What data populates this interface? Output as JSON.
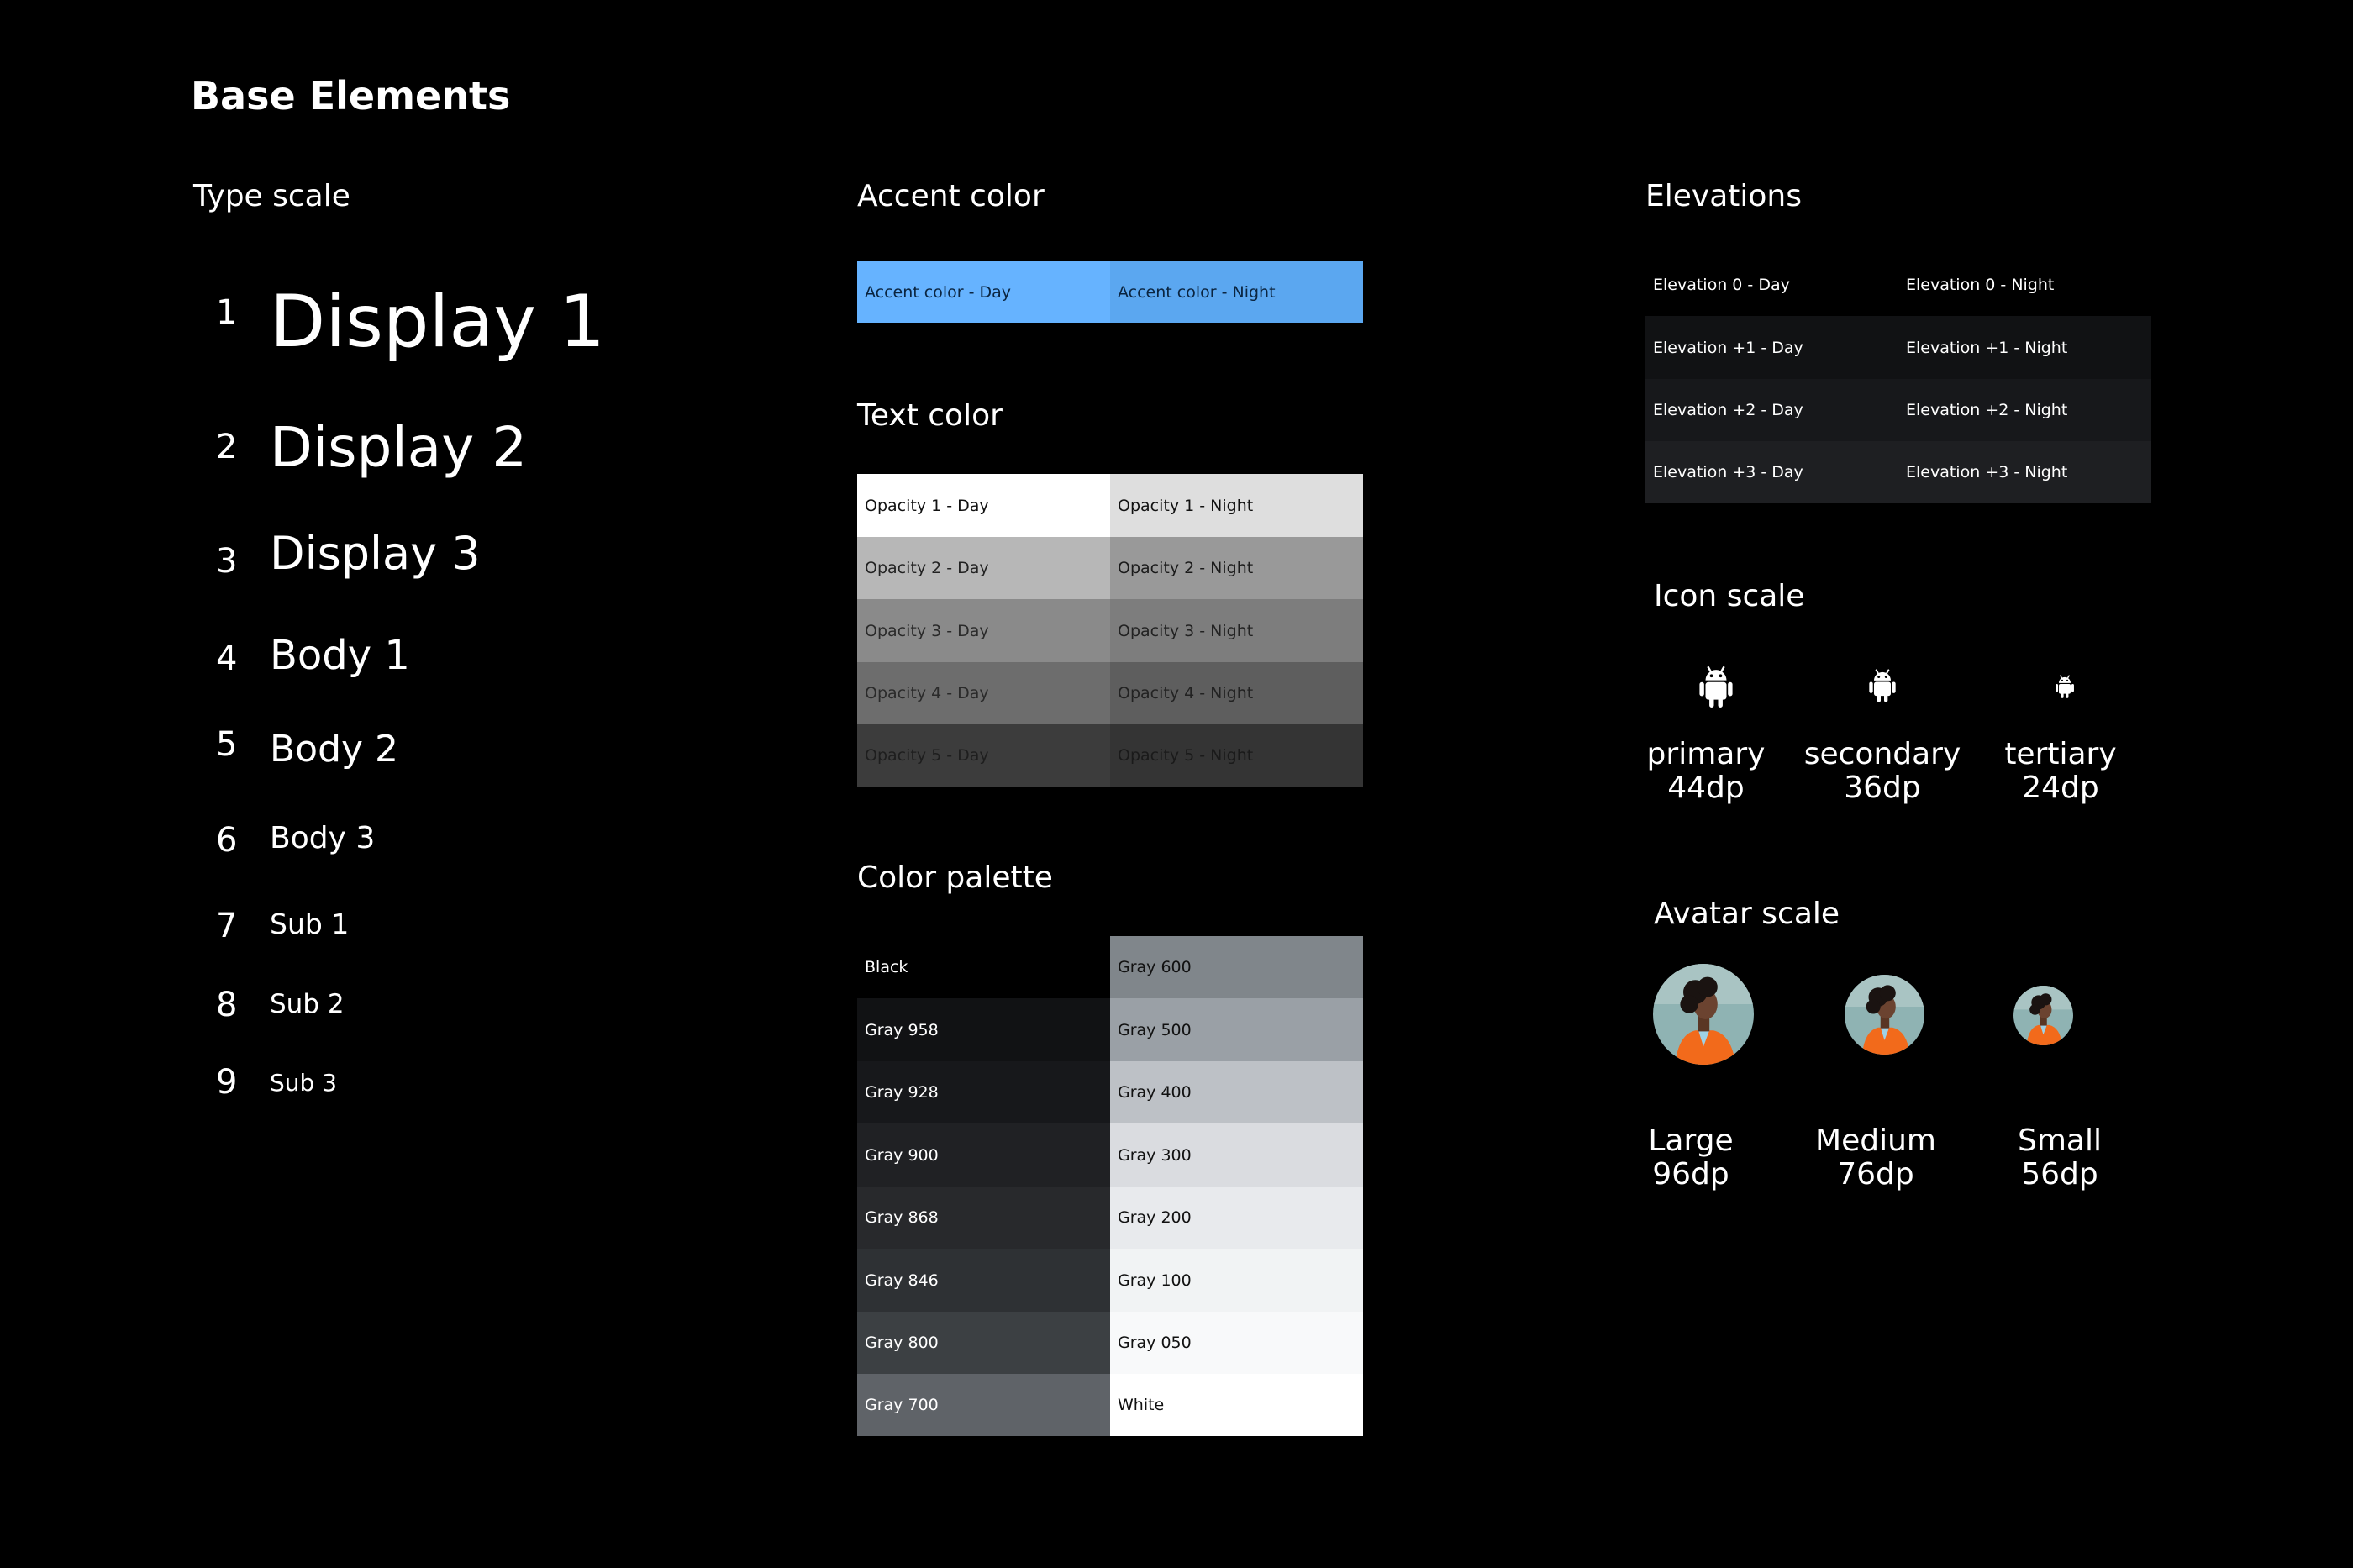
{
  "page": {
    "title": "Base Elements"
  },
  "type_scale": {
    "title": "Type scale",
    "items": [
      {
        "num": "1",
        "label": "Display 1"
      },
      {
        "num": "2",
        "label": "Display 2"
      },
      {
        "num": "3",
        "label": "Display 3"
      },
      {
        "num": "4",
        "label": "Body 1"
      },
      {
        "num": "5",
        "label": "Body 2"
      },
      {
        "num": "6",
        "label": "Body 3"
      },
      {
        "num": "7",
        "label": "Sub 1"
      },
      {
        "num": "8",
        "label": "Sub 2"
      },
      {
        "num": "9",
        "label": "Sub 3"
      }
    ]
  },
  "accent": {
    "title": "Accent color",
    "cells": [
      {
        "label": "Accent color - Day",
        "color": "#66b3ff",
        "text_color": "#0b2540"
      },
      {
        "label": "Accent color - Night",
        "color": "#5ba7f0",
        "text_color": "#0b2540"
      }
    ]
  },
  "text_color": {
    "title": "Text color",
    "rows": [
      [
        {
          "label": "Opacity 1 - Day",
          "color": "#ffffff",
          "text_color": "#111111"
        },
        {
          "label": "Opacity 1 - Night",
          "color": "#dedede",
          "text_color": "#111111"
        }
      ],
      [
        {
          "label": "Opacity 2 - Day",
          "color": "#b7b7b7",
          "text_color": "#222222"
        },
        {
          "label": "Opacity 2 - Night",
          "color": "#999999",
          "text_color": "#1a1a1a"
        }
      ],
      [
        {
          "label": "Opacity 3 - Day",
          "color": "#8a8a8a",
          "text_color": "#2a2a2a"
        },
        {
          "label": "Opacity 3 - Night",
          "color": "#7d7d7d",
          "text_color": "#222222"
        }
      ],
      [
        {
          "label": "Opacity 4 - Day",
          "color": "#6d6d6d",
          "text_color": "#2a2a2a"
        },
        {
          "label": "Opacity 4 - Night",
          "color": "#5e5e5e",
          "text_color": "#222222"
        }
      ],
      [
        {
          "label": "Opacity 5 - Day",
          "color": "#3c3c3c",
          "text_color": "#1e1e1e"
        },
        {
          "label": "Opacity 5 - Night",
          "color": "#343434",
          "text_color": "#1a1a1a"
        }
      ]
    ]
  },
  "palette": {
    "title": "Color palette",
    "left": [
      {
        "label": "Black",
        "color": "#000000",
        "text_color": "#ffffff"
      },
      {
        "label": "Gray 958",
        "color": "#111214",
        "text_color": "#ffffff"
      },
      {
        "label": "Gray 928",
        "color": "#17181b",
        "text_color": "#ffffff"
      },
      {
        "label": "Gray 900",
        "color": "#202124",
        "text_color": "#ffffff"
      },
      {
        "label": "Gray 868",
        "color": "#28292c",
        "text_color": "#ffffff"
      },
      {
        "label": "Gray 846",
        "color": "#2e3134",
        "text_color": "#ffffff"
      },
      {
        "label": "Gray 800",
        "color": "#3c4043",
        "text_color": "#ffffff"
      },
      {
        "label": "Gray 700",
        "color": "#5f6368",
        "text_color": "#ffffff"
      }
    ],
    "right": [
      {
        "label": "Gray 600",
        "color": "#80868b",
        "text_color": "#111111"
      },
      {
        "label": "Gray 500",
        "color": "#9aa0a6",
        "text_color": "#111111"
      },
      {
        "label": "Gray 400",
        "color": "#bdc1c6",
        "text_color": "#111111"
      },
      {
        "label": "Gray 300",
        "color": "#dadce0",
        "text_color": "#111111"
      },
      {
        "label": "Gray 200",
        "color": "#e8eaed",
        "text_color": "#111111"
      },
      {
        "label": "Gray 100",
        "color": "#f1f3f4",
        "text_color": "#111111"
      },
      {
        "label": "Gray 050",
        "color": "#f8f9fa",
        "text_color": "#111111"
      },
      {
        "label": "White",
        "color": "#ffffff",
        "text_color": "#111111"
      }
    ]
  },
  "elevations": {
    "title": "Elevations",
    "rows": [
      [
        {
          "label": "Elevation 0 - Day",
          "color": "#000000"
        },
        {
          "label": "Elevation 0 - Night",
          "color": "#000000"
        }
      ],
      [
        {
          "label": "Elevation +1 - Day",
          "color": "#111214"
        },
        {
          "label": "Elevation +1 - Night",
          "color": "#111214"
        }
      ],
      [
        {
          "label": "Elevation +2 - Day",
          "color": "#17181b"
        },
        {
          "label": "Elevation +2 - Night",
          "color": "#17181b"
        }
      ],
      [
        {
          "label": "Elevation +3 - Day",
          "color": "#1e1f22"
        },
        {
          "label": "Elevation +3 - Night",
          "color": "#1e1f22"
        }
      ]
    ]
  },
  "icon_scale": {
    "title": "Icon scale",
    "icon": "android-icon",
    "items": [
      {
        "name": "primary",
        "size": "44dp"
      },
      {
        "name": "secondary",
        "size": "36dp"
      },
      {
        "name": "tertiary",
        "size": "24dp"
      }
    ]
  },
  "avatar_scale": {
    "title": "Avatar scale",
    "items": [
      {
        "name": "Large",
        "size": "96dp"
      },
      {
        "name": "Medium",
        "size": "76dp"
      },
      {
        "name": "Small",
        "size": "56dp"
      }
    ]
  }
}
